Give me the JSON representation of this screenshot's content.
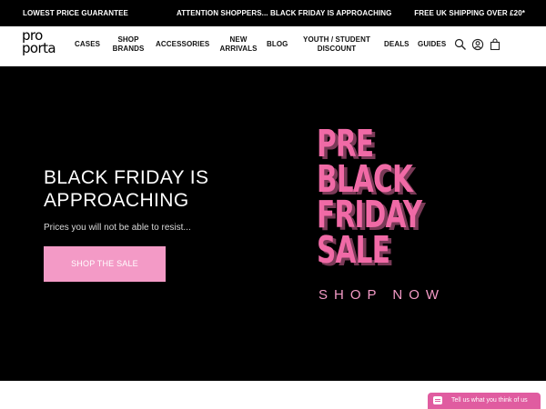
{
  "topbar": {
    "left": "LOWEST PRICE GUARANTEE",
    "center": "ATTENTION SHOPPERS... BLACK FRIDAY IS APPROACHING",
    "right": "FREE UK SHIPPING OVER £20*"
  },
  "logo": {
    "line1": "pro",
    "line2": "porta"
  },
  "nav": {
    "cases": "CASES",
    "shop_brands": [
      "SHOP",
      "BRANDS"
    ],
    "accessories": "ACCESSORIES",
    "new_arrivals": [
      "NEW",
      "ARRIVALS"
    ],
    "blog": "BLOG",
    "youth": [
      "YOUTH / STUDENT",
      "DISCOUNT"
    ],
    "deals": "DEALS",
    "guides": "GUIDES"
  },
  "icons": {
    "search": "search-icon",
    "account": "user-icon",
    "bag": "shopping-bag-icon"
  },
  "hero": {
    "title": [
      "BLACK FRIDAY IS",
      "APPROACHING"
    ],
    "subtitle": "Prices you will not be able to resist...",
    "button": "SHOP THE SALE"
  },
  "promo": {
    "words": [
      "PRE",
      "BLACK",
      "FRIDAY",
      "SALE"
    ],
    "cta": "SHOP NOW"
  },
  "feedback": {
    "label": "Tell us what you think of us"
  },
  "colors": {
    "accent_pink": "#f39ac6",
    "hero_bg": "#000000",
    "feedback_bg": "#e05ca0"
  }
}
